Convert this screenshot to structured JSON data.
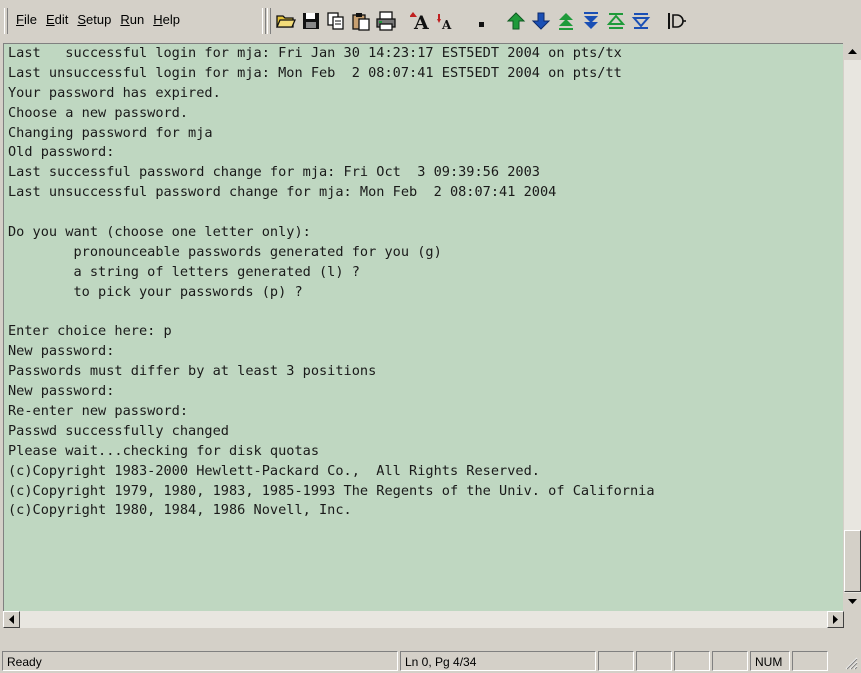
{
  "menu": [
    {
      "key": "file",
      "first": "F",
      "rest": "ile"
    },
    {
      "key": "edit",
      "first": "E",
      "rest": "dit"
    },
    {
      "key": "setup",
      "first": "S",
      "rest": "etup"
    },
    {
      "key": "run",
      "first": "R",
      "rest": "un"
    },
    {
      "key": "help",
      "first": "H",
      "rest": "elp"
    }
  ],
  "toolbar_icons": [
    "open-folder-icon",
    "save-disk-icon",
    "copy-icon",
    "paste-icon",
    "print-icon",
    "font-larger-icon",
    "font-smaller-icon",
    "small-square-icon",
    "arrow-up-icon",
    "arrow-down-icon",
    "page-up-icon",
    "page-down-icon",
    "top-icon",
    "bottom-icon",
    "disconnect-icon"
  ],
  "colors": {
    "terminal_bg": "#bfd7c1",
    "chrome": "#d4d0c8",
    "icon_dark": "#111111",
    "icon_green": "#1f9a3a",
    "icon_blue": "#1a4fb5",
    "icon_yellow": "#e6c43a"
  },
  "terminal": {
    "lines": [
      "Last   successful login for mja: Fri Jan 30 14:23:17 EST5EDT 2004 on pts/tx",
      "Last unsuccessful login for mja: Mon Feb  2 08:07:41 EST5EDT 2004 on pts/tt",
      "Your password has expired.",
      "Choose a new password.",
      "Changing password for mja",
      "Old password:",
      "Last successful password change for mja: Fri Oct  3 09:39:56 2003",
      "Last unsuccessful password change for mja: Mon Feb  2 08:07:41 2004",
      "",
      "Do you want (choose one letter only):",
      "        pronounceable passwords generated for you (g)",
      "        a string of letters generated (l) ?",
      "        to pick your passwords (p) ?",
      "",
      "Enter choice here: p",
      "New password:",
      "Passwords must differ by at least 3 positions",
      "New password:",
      "Re-enter new password:",
      "Passwd successfully changed",
      "Please wait...checking for disk quotas",
      "(c)Copyright 1983-2000 Hewlett-Packard Co.,  All Rights Reserved.",
      "(c)Copyright 1979, 1980, 1983, 1985-1993 The Regents of the Univ. of California",
      "(c)Copyright 1980, 1984, 1986 Novell, Inc."
    ]
  },
  "status": {
    "ready": "Ready",
    "position": "Ln 0, Pg 4/34",
    "num": "NUM"
  }
}
